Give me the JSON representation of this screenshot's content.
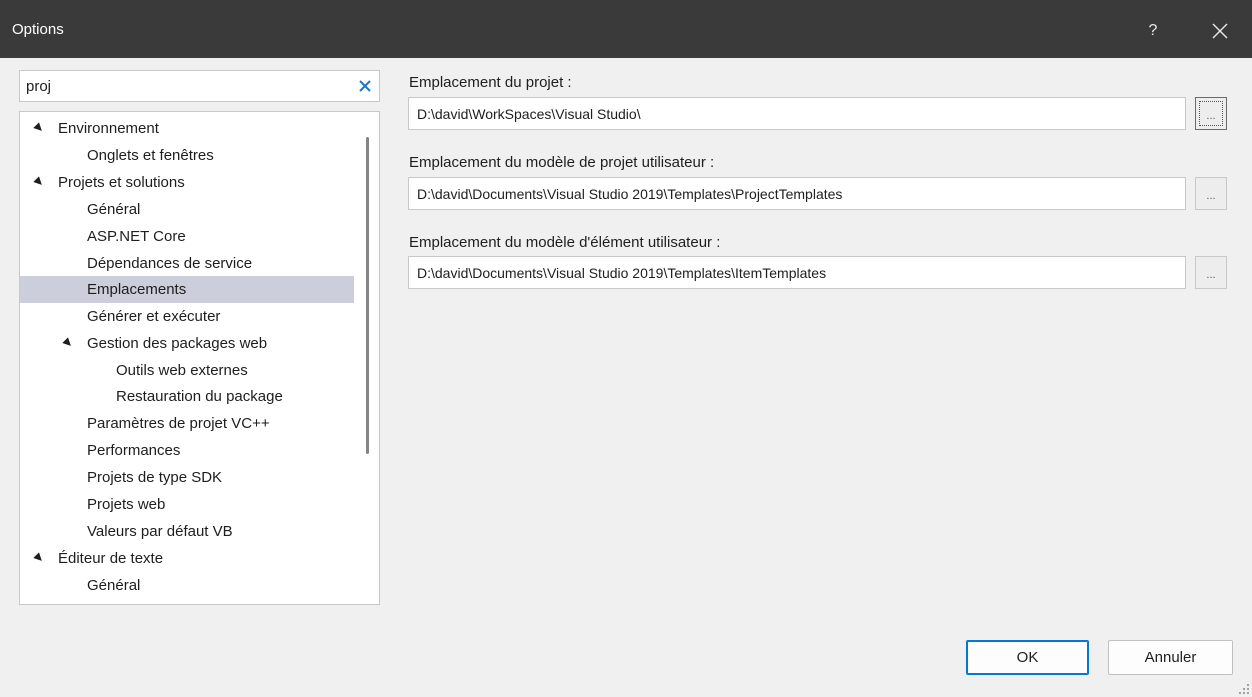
{
  "window": {
    "title": "Options",
    "help_label": "?"
  },
  "search": {
    "value": "proj"
  },
  "tree": {
    "items": [
      {
        "label": "Environnement",
        "expanded": true
      },
      {
        "label": "Onglets et fenêtres"
      },
      {
        "label": "Projets et solutions",
        "expanded": true
      },
      {
        "label": "Général"
      },
      {
        "label": "ASP.NET Core"
      },
      {
        "label": "Dépendances de service"
      },
      {
        "label": "Emplacements",
        "selected": true
      },
      {
        "label": "Générer et exécuter"
      },
      {
        "label": "Gestion des packages web",
        "expanded": true
      },
      {
        "label": "Outils web externes"
      },
      {
        "label": "Restauration du package"
      },
      {
        "label": "Paramètres de projet VC++"
      },
      {
        "label": "Performances"
      },
      {
        "label": "Projets de type SDK"
      },
      {
        "label": "Projets web"
      },
      {
        "label": "Valeurs par défaut VB"
      },
      {
        "label": "Éditeur de texte",
        "expanded": true
      },
      {
        "label": "Général"
      }
    ]
  },
  "fields": {
    "project_location": {
      "label": "Emplacement du projet :",
      "value": "D:\\david\\WorkSpaces\\Visual Studio\\",
      "browse_label": "..."
    },
    "project_template_location": {
      "label": "Emplacement du modèle de projet utilisateur :",
      "value": "D:\\david\\Documents\\Visual Studio 2019\\Templates\\ProjectTemplates",
      "browse_label": "..."
    },
    "item_template_location": {
      "label": "Emplacement du modèle d'élément utilisateur :",
      "value": "D:\\david\\Documents\\Visual Studio 2019\\Templates\\ItemTemplates",
      "browse_label": "..."
    }
  },
  "buttons": {
    "ok": "OK",
    "cancel": "Annuler"
  },
  "colors": {
    "titlebar": "#3a3a3a",
    "selection": "#cccedb",
    "accent": "#0078d7",
    "clear_icon": "#1e78c8"
  }
}
